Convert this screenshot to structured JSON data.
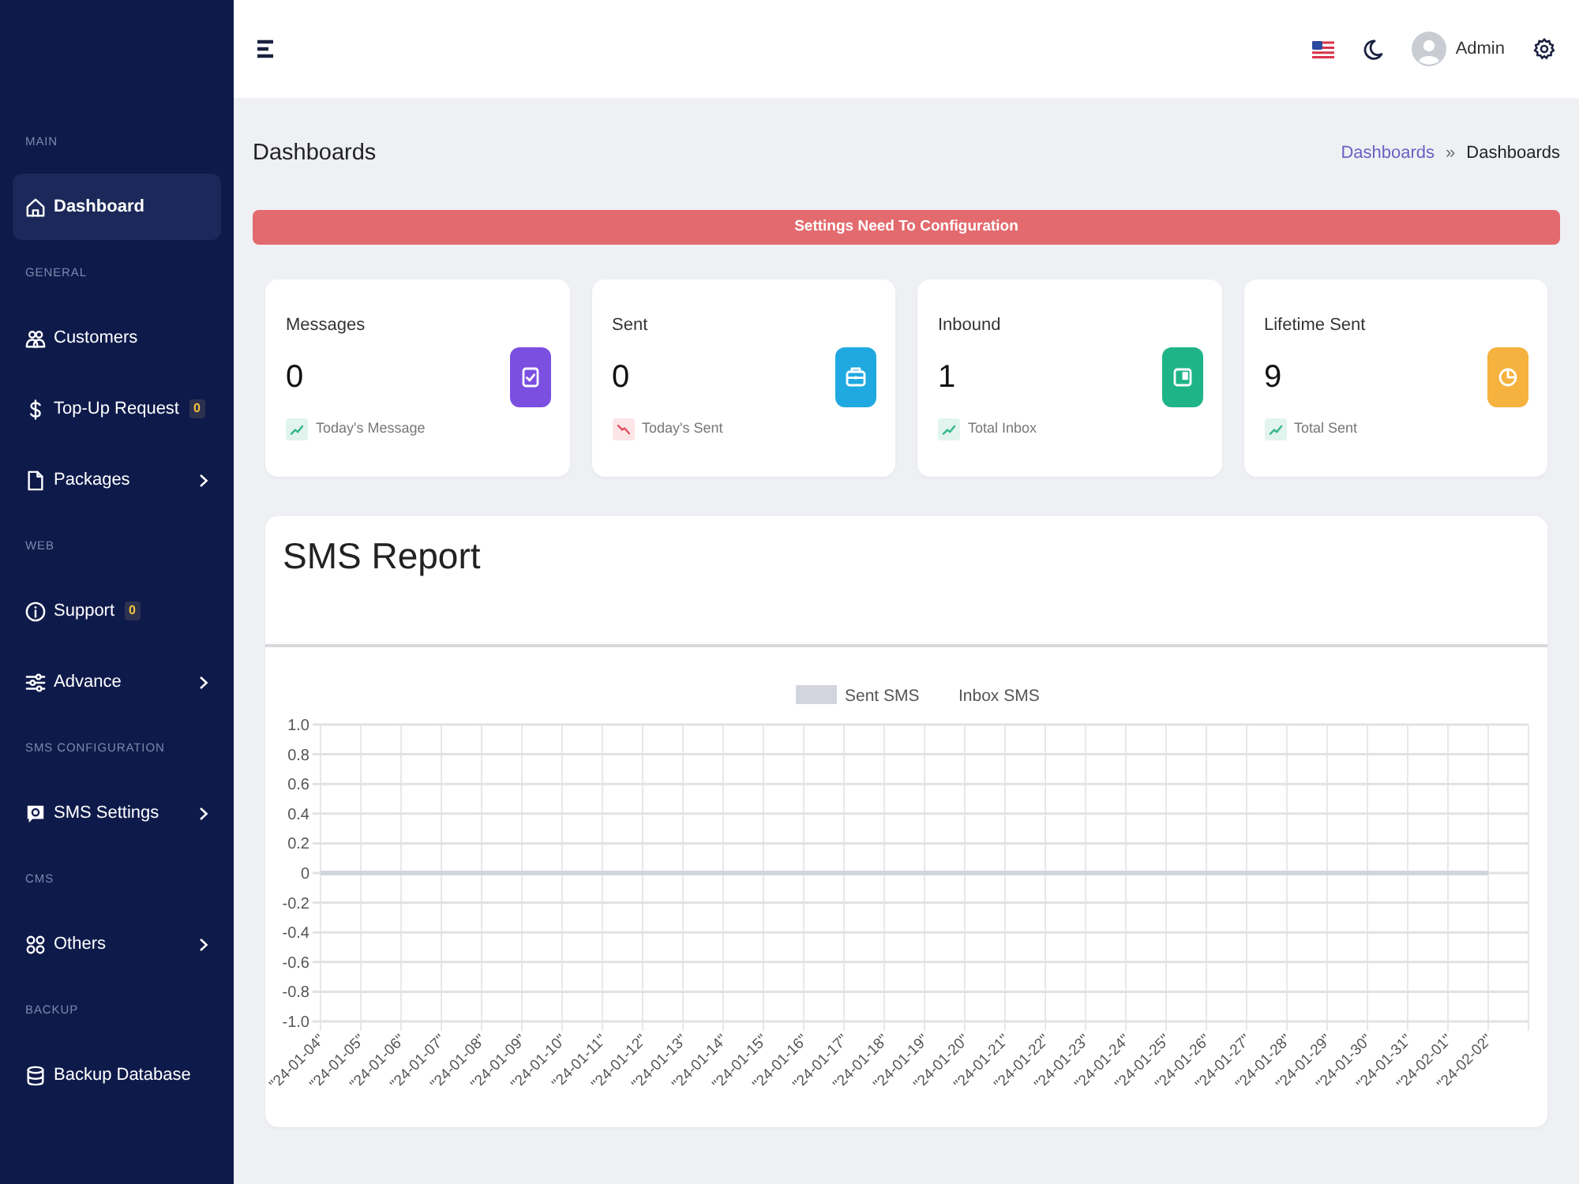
{
  "header": {
    "user_name": "Admin"
  },
  "sidebar": {
    "sections": [
      {
        "heading": "MAIN",
        "items": [
          {
            "label": "Dashboard",
            "selected": true
          }
        ]
      },
      {
        "heading": "GENERAL",
        "items": [
          {
            "label": "Customers",
            "selected": false
          },
          {
            "label": "Top-Up Request",
            "selected": false,
            "badge": "0"
          },
          {
            "label": "Packages",
            "selected": false,
            "expanded": false
          }
        ]
      },
      {
        "heading": "WEB",
        "items": [
          {
            "label": "Support",
            "selected": false,
            "badge": "0"
          },
          {
            "label": "Advance",
            "selected": false,
            "expanded": false
          }
        ]
      },
      {
        "heading": "SMS CONFIGURATION",
        "items": [
          {
            "label": "SMS Settings",
            "selected": false,
            "expanded": false
          }
        ]
      },
      {
        "heading": "CMS",
        "items": [
          {
            "label": "Others",
            "selected": false,
            "expanded": false
          }
        ]
      },
      {
        "heading": "BACKUP",
        "items": [
          {
            "label": "Backup Database",
            "selected": false
          }
        ]
      }
    ]
  },
  "page_header": {
    "title": "Dashboards",
    "breadcrumb": [
      {
        "label": "Dashboards",
        "kind": "link"
      },
      {
        "label": "Dashboards",
        "kind": "current"
      }
    ],
    "breadcrumb_separator": "»"
  },
  "alert": {
    "kind": "danger",
    "text": "Settings Need To Configuration"
  },
  "stats": [
    {
      "title": "Messages",
      "value": "0",
      "color": "#7b4fe0",
      "rising": true,
      "caption": "Today's Message"
    },
    {
      "title": "Sent",
      "value": "0",
      "color": "#20a9e0",
      "rising": false,
      "caption": "Today's Sent"
    },
    {
      "title": "Inbound",
      "value": "1",
      "color": "#1fb488",
      "rising": true,
      "caption": "Total Inbox"
    },
    {
      "title": "Lifetime Sent",
      "value": "9",
      "color": "#f5b23e",
      "rising": true,
      "caption": "Total Sent"
    }
  ],
  "sms_report": {
    "title": "SMS Report",
    "chart_data": {
      "type": "line",
      "grid": true,
      "categories": [
        "\"24-01-04\"",
        "\"24-01-05\"",
        "\"24-01-06\"",
        "\"24-01-07\"",
        "\"24-01-08\"",
        "\"24-01-09\"",
        "\"24-01-10\"",
        "\"24-01-11\"",
        "\"24-01-12\"",
        "\"24-01-13\"",
        "\"24-01-14\"",
        "\"24-01-15\"",
        "\"24-01-16\"",
        "\"24-01-17\"",
        "\"24-01-18\"",
        "\"24-01-19\"",
        "\"24-01-20\"",
        "\"24-01-21\"",
        "\"24-01-22\"",
        "\"24-01-23\"",
        "\"24-01-24\"",
        "\"24-01-25\"",
        "\"24-01-26\"",
        "\"24-01-27\"",
        "\"24-01-28\"",
        "\"24-01-29\"",
        "\"24-01-30\"",
        "\"24-01-31\"",
        "\"24-02-01\"",
        "\"24-02-02\""
      ],
      "series": [
        {
          "name": "Sent SMS",
          "color": "#d2d5de",
          "values": [
            0,
            0,
            0,
            0,
            0,
            0,
            0,
            0,
            0,
            0,
            0,
            0,
            0,
            0,
            0,
            0,
            0,
            0,
            0,
            0,
            0,
            0,
            0,
            0,
            0,
            0,
            0,
            0,
            0,
            0
          ]
        },
        {
          "name": "Inbox SMS",
          "values": [
            null,
            null,
            null,
            null,
            null,
            null,
            null,
            null,
            null,
            null,
            null,
            null,
            null,
            null,
            null,
            null,
            null,
            null,
            null,
            null,
            null,
            null,
            null,
            null,
            null,
            null,
            null,
            null,
            null,
            null
          ]
        }
      ],
      "ylim": [
        -1,
        1
      ],
      "yticks": [
        {
          "value": 1,
          "label": "1.0"
        },
        0.8,
        0.6,
        0.4,
        0.2,
        0,
        -0.2,
        -0.4,
        -0.6,
        -0.8,
        {
          "value": -1,
          "label": "-1.0"
        }
      ]
    }
  }
}
